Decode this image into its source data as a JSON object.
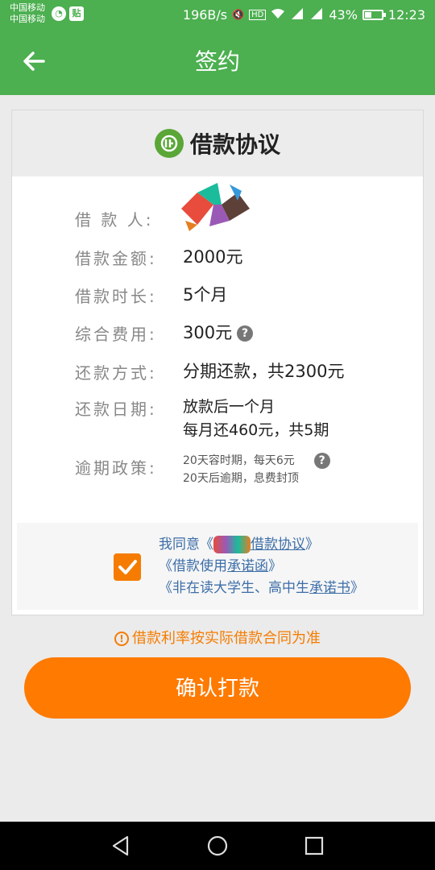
{
  "status_bar": {
    "carrier1": "中国移动",
    "carrier2": "中国移动",
    "tie_badge": "贴",
    "speed": "196B/s",
    "battery_percent": "43%",
    "battery_level": 0.43,
    "time": "12:23",
    "icons": [
      "mute-icon",
      "hd-icon",
      "wifi-icon",
      "signal-2g-icon",
      "signal-4g-icon",
      "battery-icon"
    ]
  },
  "app_bar": {
    "title": "签约",
    "back_icon": "arrow-left-icon"
  },
  "agreement": {
    "title": "借款协议",
    "rows": [
      {
        "label": "借 款 人:",
        "value": ""
      },
      {
        "label": "借款金额:",
        "value": "2000元"
      },
      {
        "label": "借款时长:",
        "value": "5个月"
      },
      {
        "label": "综合费用:",
        "value": "300元"
      },
      {
        "label": "还款方式:",
        "value": "分期还款，共2300元"
      },
      {
        "label": "还款日期:",
        "value_lines": [
          "放款后一个月",
          "每月还460元，共5期"
        ]
      },
      {
        "label": "逾期政策:",
        "value_lines": [
          "20天容时期，每天6元",
          "20天后逾期，息费封顶"
        ]
      }
    ],
    "help_icon": "?"
  },
  "consent": {
    "line1_prefix": "我同意《",
    "line1_link": "借款协议",
    "line1_suffix": "》",
    "line2_prefix": "《借款使用",
    "line2_link": "承诺函",
    "line2_suffix": "》",
    "line3_prefix": "《非在读大学生、高中生",
    "line3_link": "承诺书",
    "line3_suffix": "》",
    "checked": true
  },
  "notice": {
    "icon": "!",
    "text": "借款利率按实际借款合同为准"
  },
  "confirm_button": {
    "label": "确认打款"
  },
  "colors": {
    "primary_green": "#4caf50",
    "accent_orange": "#ff7a00",
    "link_blue": "#3d6ea8"
  }
}
